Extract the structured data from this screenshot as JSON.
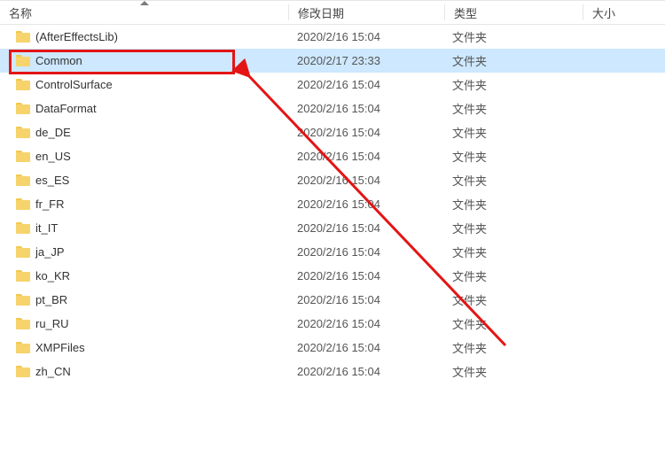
{
  "columns": {
    "name": "名称",
    "date": "修改日期",
    "type": "类型",
    "size": "大小"
  },
  "sort": {
    "column": "name",
    "direction": "asc"
  },
  "items": [
    {
      "name": "(AfterEffectsLib)",
      "date": "2020/2/16 15:04",
      "type": "文件夹",
      "selected": false
    },
    {
      "name": "Common",
      "date": "2020/2/17 23:33",
      "type": "文件夹",
      "selected": true
    },
    {
      "name": "ControlSurface",
      "date": "2020/2/16 15:04",
      "type": "文件夹",
      "selected": false
    },
    {
      "name": "DataFormat",
      "date": "2020/2/16 15:04",
      "type": "文件夹",
      "selected": false
    },
    {
      "name": "de_DE",
      "date": "2020/2/16 15:04",
      "type": "文件夹",
      "selected": false
    },
    {
      "name": "en_US",
      "date": "2020/2/16 15:04",
      "type": "文件夹",
      "selected": false
    },
    {
      "name": "es_ES",
      "date": "2020/2/16 15:04",
      "type": "文件夹",
      "selected": false
    },
    {
      "name": "fr_FR",
      "date": "2020/2/16 15:04",
      "type": "文件夹",
      "selected": false
    },
    {
      "name": "it_IT",
      "date": "2020/2/16 15:04",
      "type": "文件夹",
      "selected": false
    },
    {
      "name": "ja_JP",
      "date": "2020/2/16 15:04",
      "type": "文件夹",
      "selected": false
    },
    {
      "name": "ko_KR",
      "date": "2020/2/16 15:04",
      "type": "文件夹",
      "selected": false
    },
    {
      "name": "pt_BR",
      "date": "2020/2/16 15:04",
      "type": "文件夹",
      "selected": false
    },
    {
      "name": "ru_RU",
      "date": "2020/2/16 15:04",
      "type": "文件夹",
      "selected": false
    },
    {
      "name": "XMPFiles",
      "date": "2020/2/16 15:04",
      "type": "文件夹",
      "selected": false
    },
    {
      "name": "zh_CN",
      "date": "2020/2/16 15:04",
      "type": "文件夹",
      "selected": false
    }
  ],
  "annotation": {
    "highlight_color": "#e31515",
    "box_target_index": 1
  }
}
